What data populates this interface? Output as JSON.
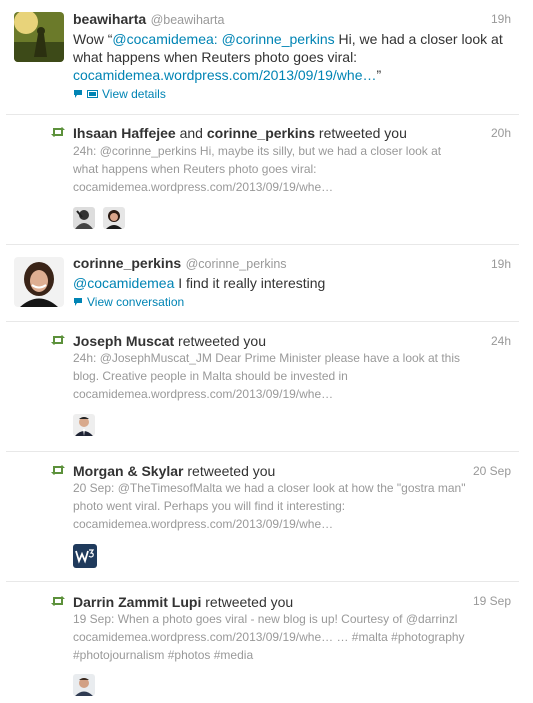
{
  "tweet1": {
    "name": "beawiharta",
    "handle": "@beawiharta",
    "time": "19h",
    "line1_pre": "Wow “",
    "mention1": "@cocamidemea",
    "mention2": ": @corinne_perkins",
    "line1_post": " Hi, we had a closer look at",
    "line2": "what happens when Reuters photo goes viral:",
    "line3_link": "cocamidemea.wordpress.com/2013/09/19/whe…",
    "line3_post": "”",
    "action": "View details"
  },
  "rt1": {
    "name_a": "Ihsaan Haffejee",
    "joiner": " and ",
    "name_b": "corinne_perkins",
    "suffix": " retweeted you",
    "time": "20h",
    "lines": [
      "24h: @corinne_perkins Hi, maybe its silly, but we had a closer look at",
      "what happens when Reuters photo goes viral:",
      "cocamidemea.wordpress.com/2013/09/19/whe…"
    ]
  },
  "tweet2": {
    "name": "corinne_perkins",
    "handle": "@corinne_perkins",
    "time": "19h",
    "mention": "@cocamidemea",
    "text": " I find it really interesting",
    "action": "View conversation"
  },
  "rt2": {
    "name": "Joseph Muscat",
    "suffix": " retweeted you",
    "time": "24h",
    "lines": [
      "24h: @JosephMuscat_JM Dear Prime Minister  please have a look at this",
      "blog. Creative people in Malta should be invested in",
      "cocamidemea.wordpress.com/2013/09/19/whe…"
    ]
  },
  "rt3": {
    "name": "Morgan & Skylar",
    "suffix": " retweeted you",
    "time": "20 Sep",
    "lines": [
      "20 Sep: @TheTimesofMalta we had a closer look at how the \"gostra man\"",
      "photo went viral. Perhaps you will find it interesting:",
      "cocamidemea.wordpress.com/2013/09/19/whe…"
    ]
  },
  "rt4": {
    "name": "Darrin Zammit Lupi",
    "suffix": " retweeted you",
    "time": "19 Sep",
    "lines": [
      "19 Sep: When a photo goes viral - new blog is up! Courtesy of @darrinzl",
      "cocamidemea.wordpress.com/2013/09/19/whe… … #malta #photography",
      "#photojournalism #photos #media"
    ]
  },
  "colors": {
    "link": "#0084b4",
    "retweet": "#5c913b",
    "muted": "#999999"
  },
  "icons": [
    "retweet-icon",
    "comment-icon",
    "media-icon"
  ]
}
